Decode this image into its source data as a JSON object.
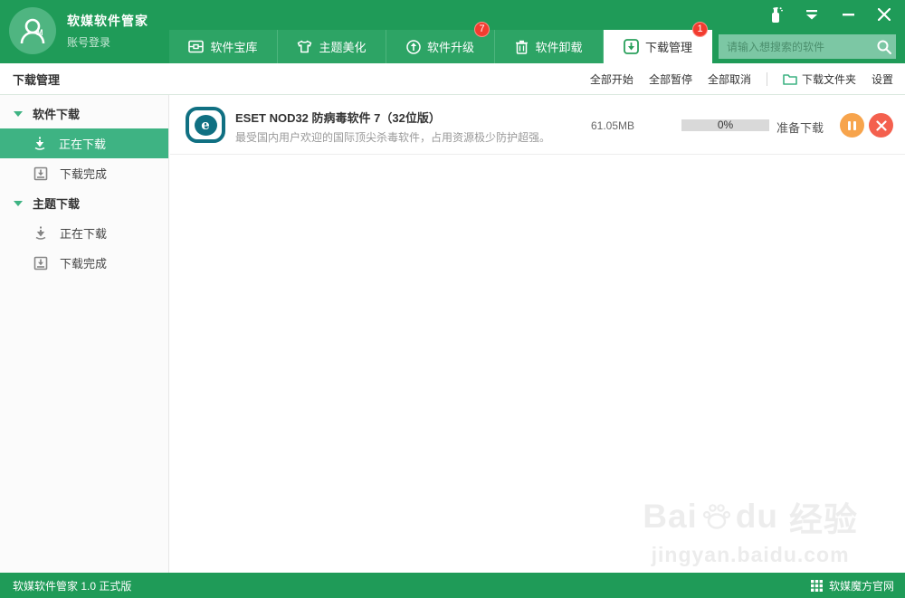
{
  "colors": {
    "header_green": "#1f9b58",
    "tab_green": "#2da465",
    "selected_green": "#3eb383",
    "badge_red": "#f23c30",
    "pause_orange": "#f7a44c",
    "cancel_red": "#f4604e",
    "eset_teal": "#107082",
    "search_bg": "#7cc7a4"
  },
  "header": {
    "app_title": "软媒软件管家",
    "account_label": "账号登录",
    "window_controls": [
      {
        "icon": "spray-bottle-icon"
      },
      {
        "icon": "dropdown-icon"
      },
      {
        "icon": "minimize-icon"
      },
      {
        "icon": "close-icon"
      }
    ]
  },
  "tabs": [
    {
      "label": "软件宝库",
      "icon": "treasure-box-icon"
    },
    {
      "label": "主题美化",
      "icon": "tshirt-icon"
    },
    {
      "label": "软件升级",
      "icon": "upgrade-arrow-icon",
      "badge": "7"
    },
    {
      "label": "软件卸载",
      "icon": "trash-icon"
    },
    {
      "label": "下载管理",
      "icon": "download-box-icon",
      "badge": "1",
      "active": true
    }
  ],
  "search": {
    "placeholder": "请输入想搜索的软件",
    "icon": "search-icon"
  },
  "toolbar": {
    "page_title": "下载管理",
    "start_all": "全部开始",
    "pause_all": "全部暂停",
    "cancel_all": "全部取消",
    "folder_label": "下载文件夹",
    "settings_label": "设置"
  },
  "sidebar": {
    "groups": [
      {
        "label": "软件下载",
        "items": [
          {
            "label": "正在下载",
            "icon": "downloading-icon",
            "selected": true
          },
          {
            "label": "下载完成",
            "icon": "download-complete-icon"
          }
        ]
      },
      {
        "label": "主题下载",
        "items": [
          {
            "label": "正在下载",
            "icon": "downloading-icon"
          },
          {
            "label": "下载完成",
            "icon": "download-complete-icon"
          }
        ]
      }
    ]
  },
  "downloads": [
    {
      "name": "ESET NOD32 防病毒软件 7（32位版）",
      "description": "最受国内用户欢迎的国际顶尖杀毒软件，占用资源极少防护超强。",
      "size": "61.05MB",
      "progress_percent": "0%",
      "status": "准备下载",
      "logo_letter": "e"
    }
  ],
  "watermark": {
    "brand_left": "Bai",
    "brand_right": "du",
    "brand_suffix": "经验",
    "url": "jingyan.baidu.com"
  },
  "statusbar": {
    "version": "软媒软件管家 1.0 正式版",
    "site": "软媒魔方官网"
  }
}
